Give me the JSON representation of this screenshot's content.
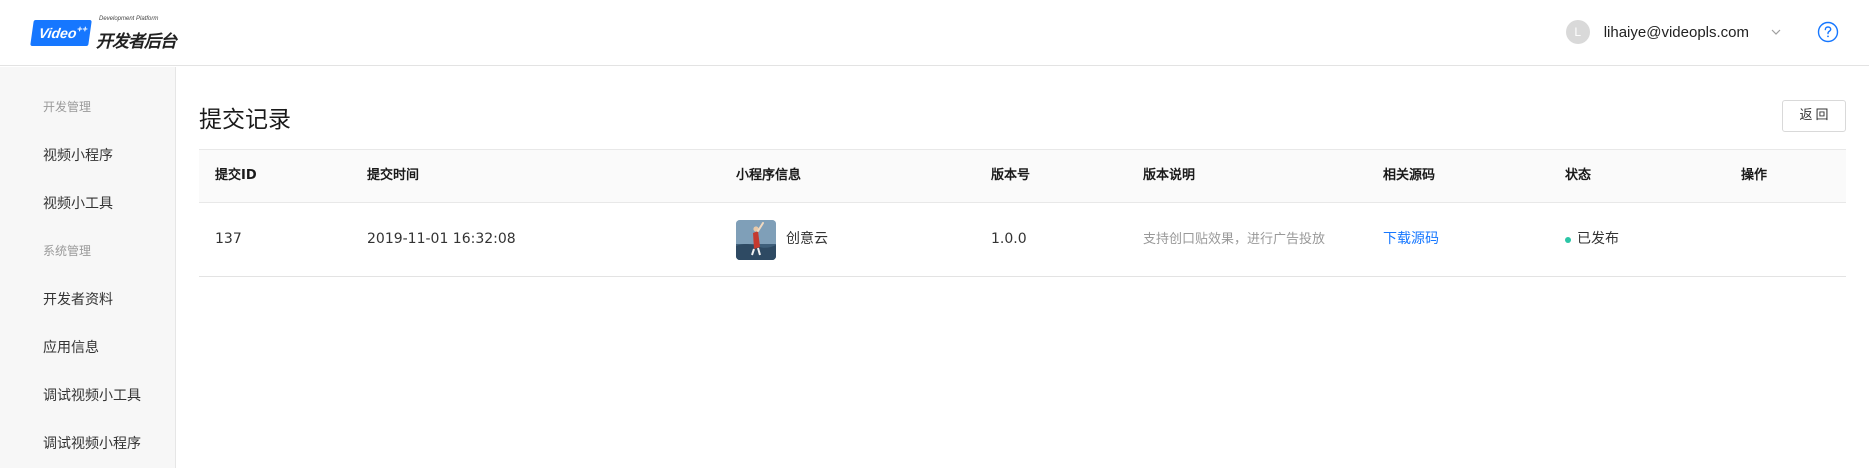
{
  "brand": {
    "logo_badge": "Video",
    "logo_badge_sup": "++",
    "logo_subtitle": "Development Platform",
    "logo_title": "开发者后台"
  },
  "user": {
    "avatar_initial": "L",
    "email": "lihaiye@videopls.com"
  },
  "sidebar": {
    "groups": [
      {
        "label": "开发管理",
        "items": [
          {
            "label": "视频小程序"
          },
          {
            "label": "视频小工具"
          }
        ]
      },
      {
        "label": "系统管理",
        "items": [
          {
            "label": "开发者资料"
          },
          {
            "label": "应用信息"
          },
          {
            "label": "调试视频小工具"
          },
          {
            "label": "调试视频小程序"
          }
        ]
      }
    ]
  },
  "main": {
    "title": "提交记录",
    "back_label": "返回"
  },
  "table": {
    "columns": [
      "提交ID",
      "提交时间",
      "小程序信息",
      "版本号",
      "版本说明",
      "相关源码",
      "状态",
      "操作"
    ],
    "rows": [
      {
        "id": "137",
        "time": "2019-11-01 16:32:08",
        "app_name": "创意云",
        "version": "1.0.0",
        "description": "支持创口贴效果，进行广告投放",
        "source_link": "下载源码",
        "status": "已发布",
        "action": ""
      }
    ]
  },
  "colors": {
    "accent": "#1677ff",
    "status_published": "#2bc5a6"
  },
  "icons": {
    "user_menu": "chevron-down-icon",
    "help": "help-circle-icon"
  }
}
